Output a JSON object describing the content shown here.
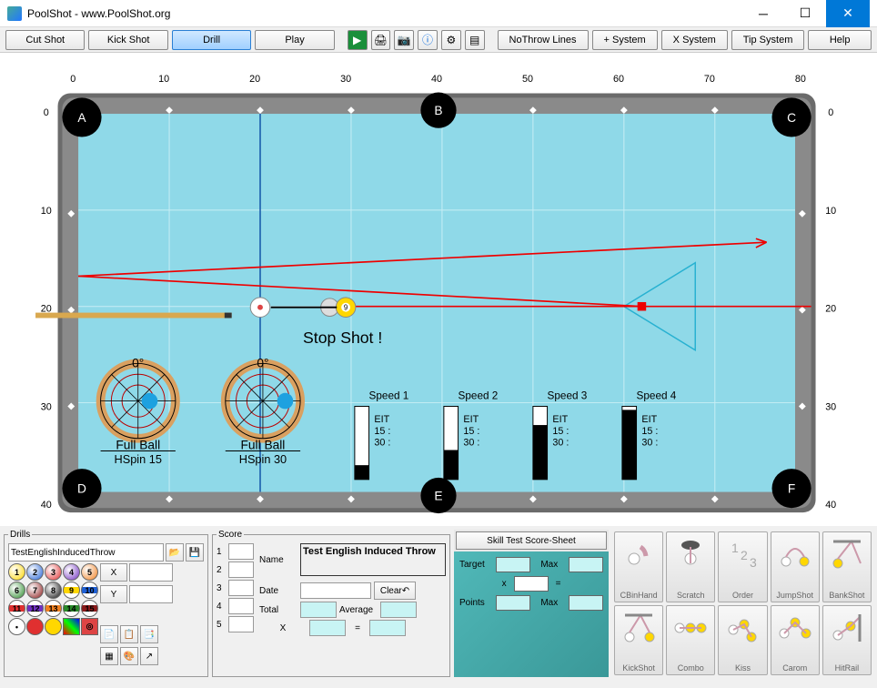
{
  "window": {
    "title": "PoolShot - www.PoolShot.org"
  },
  "toolbar": {
    "cut_shot": "Cut Shot",
    "kick_shot": "Kick Shot",
    "drill": "Drill",
    "play": "Play",
    "nothrow": "NoThrow Lines",
    "plus_sys": "+ System",
    "x_sys": "X System",
    "tip_sys": "Tip System",
    "help": "Help"
  },
  "table": {
    "pockets": {
      "a": "A",
      "b": "B",
      "c": "C",
      "d": "D",
      "e": "E",
      "f": "F"
    },
    "top_ticks": [
      "0",
      "10",
      "20",
      "30",
      "40",
      "50",
      "60",
      "70",
      "80"
    ],
    "side_ticks": [
      "0",
      "10",
      "20",
      "30",
      "40"
    ],
    "stop_shot": "Stop Shot !",
    "hit1": {
      "angle": "0°",
      "label": "Full Ball",
      "spin": "HSpin 15"
    },
    "hit2": {
      "angle": "0°",
      "label": "Full Ball",
      "spin": "HSpin 30"
    },
    "speeds": [
      {
        "label": "Speed 1",
        "eit": "EIT",
        "l15": "15 :",
        "l30": "30 :",
        "fill": 0.2
      },
      {
        "label": "Speed 2",
        "eit": "EIT",
        "l15": "15 :",
        "l30": "30 :",
        "fill": 0.4
      },
      {
        "label": "Speed 3",
        "eit": "EIT",
        "l15": "15 :",
        "l30": "30 :",
        "fill": 0.75
      },
      {
        "label": "Speed 4",
        "eit": "EIT",
        "l15": "15 :",
        "l30": "30 :",
        "fill": 0.95
      }
    ]
  },
  "drills": {
    "legend": "Drills",
    "filename": "TestEnglishInducedThrow",
    "x": "X",
    "y": "Y"
  },
  "score": {
    "legend": "Score",
    "name_lbl": "Name",
    "name_val": "Test English Induced Throw",
    "date_lbl": "Date",
    "clear": "Clear",
    "total_lbl": "Total",
    "avg_lbl": "Average",
    "x_lbl": "X",
    "eq": "=",
    "rows": [
      "1",
      "2",
      "3",
      "4",
      "5"
    ]
  },
  "test": {
    "button": "Skill Test Score-Sheet",
    "target": "Target",
    "max": "Max",
    "x": "x",
    "eq": "=",
    "points": "Points",
    "max2": "Max"
  },
  "shots": {
    "cbinhand": "CBinHand",
    "scratch": "Scratch",
    "order": "Order",
    "jump": "JumpShot",
    "bank": "BankShot",
    "kick": "KickShot",
    "combo": "Combo",
    "kiss": "Kiss",
    "carom": "Carom",
    "hitrail": "HitRail"
  }
}
